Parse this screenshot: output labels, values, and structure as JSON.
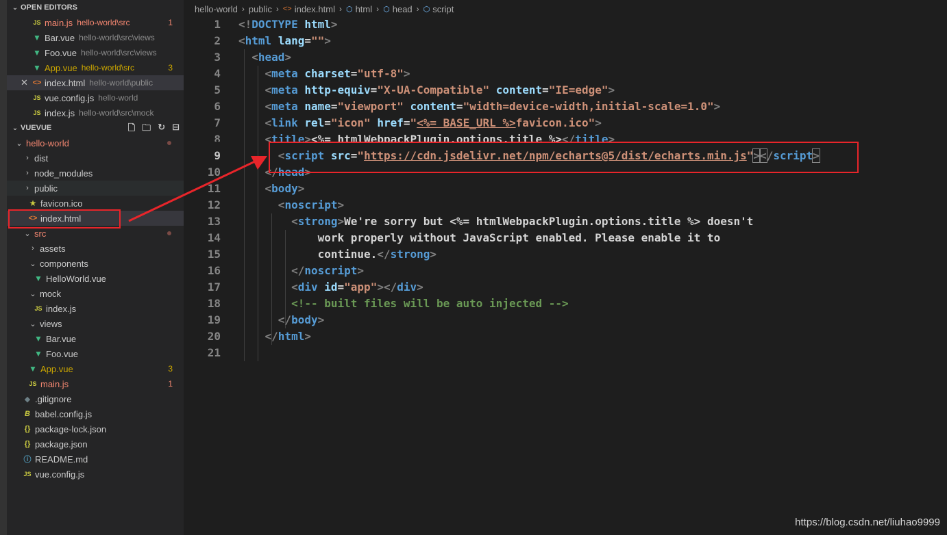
{
  "open_editors": {
    "title": "OPEN EDITORS",
    "items": [
      {
        "icon": "JS",
        "name": "main.js",
        "path": "hello-world\\src",
        "badge": "1",
        "state": "err"
      },
      {
        "icon": "V",
        "name": "Bar.vue",
        "path": "hello-world\\src\\views",
        "badge": "",
        "state": ""
      },
      {
        "icon": "V",
        "name": "Foo.vue",
        "path": "hello-world\\src\\views",
        "badge": "",
        "state": ""
      },
      {
        "icon": "V",
        "name": "App.vue",
        "path": "hello-world\\src",
        "badge": "3",
        "state": "warn"
      },
      {
        "icon": "<>",
        "name": "index.html",
        "path": "hello-world\\public",
        "badge": "",
        "state": "active"
      },
      {
        "icon": "JS",
        "name": "vue.config.js",
        "path": "hello-world",
        "badge": "",
        "state": ""
      },
      {
        "icon": "JS",
        "name": "index.js",
        "path": "hello-world\\src\\mock",
        "badge": "",
        "state": ""
      }
    ]
  },
  "explorer": {
    "title": "VUEVUE",
    "tree": {
      "hello_world": "hello-world",
      "dist": "dist",
      "node_modules": "node_modules",
      "public": "public",
      "favicon": "favicon.ico",
      "index_html": "index.html",
      "src": "src",
      "assets": "assets",
      "components": "components",
      "helloworld_vue": "HelloWorld.vue",
      "mock": "mock",
      "mock_index": "index.js",
      "views": "views",
      "bar_vue": "Bar.vue",
      "foo_vue": "Foo.vue",
      "app_vue": "App.vue",
      "app_badge": "3",
      "main_js": "main.js",
      "main_badge": "1",
      "gitignore": ".gitignore",
      "babel": "babel.config.js",
      "pkg_lock": "package-lock.json",
      "pkg": "package.json",
      "readme": "README.md",
      "vue_config": "vue.config.js"
    }
  },
  "breadcrumb": [
    "hello-world",
    "public",
    "index.html",
    "html",
    "head",
    "script"
  ],
  "code": {
    "l1a": "<!",
    "l1b": "DOCTYPE",
    "l1c": " html",
    "l1d": ">",
    "l13_text": "We're sorry but ",
    "l13_tpl": "<%= htmlWebpackPlugin.options.title %>",
    "l13_rest": " doesn't",
    "l14": "work properly without JavaScript enabled. Please enable it to",
    "l15": "continue.",
    "l18": "<!-- built files will be auto injected -->",
    "l7_tpl": "<%= BASE_URL %>",
    "l7_rest": "favicon.ico",
    "l6_content": "width=device-width,initial-scale=1.0",
    "l9_src": "https://cdn.jsdelivr.net/npm/echarts@5/dist/echarts.min.js",
    "l8_tpl": "<%= htmlWebpackPlugin.options.title %>"
  },
  "line_numbers": [
    "1",
    "2",
    "3",
    "4",
    "5",
    "6",
    "7",
    "8",
    "9",
    "10",
    "11",
    "12",
    "13",
    "14",
    "15",
    "16",
    "17",
    "18",
    "19",
    "20",
    "21"
  ],
  "watermark": "https://blog.csdn.net/liuhao9999"
}
